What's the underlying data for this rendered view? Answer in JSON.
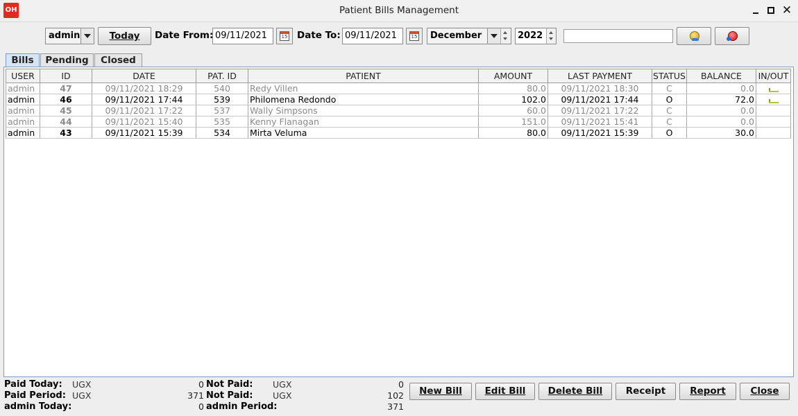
{
  "window": {
    "title": "Patient Bills Management",
    "app_logo": "OH"
  },
  "toolbar": {
    "user_select": "admin",
    "today_label": "Today",
    "date_from_label": "Date From:",
    "date_from_value": "09/11/2021",
    "date_to_label": "Date To:",
    "date_to_value": "09/11/2021",
    "month_select": "December",
    "year_value": "2022",
    "search_value": "",
    "calendar_day": "15",
    "icons": [
      "coin-icon",
      "delete-patient-icon",
      "calendar-icon"
    ]
  },
  "tabs": [
    "Bills",
    "Pending",
    "Closed"
  ],
  "active_tab": "Bills",
  "table": {
    "columns": [
      "USER",
      "ID",
      "DATE",
      "PAT. ID",
      "PATIENT",
      "AMOUNT",
      "LAST PAYMENT",
      "STATUS",
      "BALANCE",
      "IN/OUT"
    ],
    "rows": [
      {
        "user": "admin",
        "id": "47",
        "date": "09/11/2021 18:29",
        "pat_id": "540",
        "patient": "Redy Villen",
        "amount": "80.0",
        "last_payment": "09/11/2021 18:30",
        "status": "C",
        "balance": "0.0",
        "in_out": "in",
        "closed": true
      },
      {
        "user": "admin",
        "id": "46",
        "date": "09/11/2021 17:44",
        "pat_id": "539",
        "patient": "Philomena Redondo",
        "amount": "102.0",
        "last_payment": "09/11/2021 17:44",
        "status": "O",
        "balance": "72.0",
        "in_out": "in",
        "closed": false
      },
      {
        "user": "admin",
        "id": "45",
        "date": "09/11/2021 17:22",
        "pat_id": "537",
        "patient": "Wally Simpsons",
        "amount": "60.0",
        "last_payment": "09/11/2021 17:22",
        "status": "C",
        "balance": "0.0",
        "in_out": "",
        "closed": true
      },
      {
        "user": "admin",
        "id": "44",
        "date": "09/11/2021 15:40",
        "pat_id": "535",
        "patient": "Kenny Flanagan",
        "amount": "151.0",
        "last_payment": "09/11/2021 15:41",
        "status": "C",
        "balance": "0.0",
        "in_out": "",
        "closed": true
      },
      {
        "user": "admin",
        "id": "43",
        "date": "09/11/2021 15:39",
        "pat_id": "534",
        "patient": "Mirta Veluma",
        "amount": "80.0",
        "last_payment": "09/11/2021 15:39",
        "status": "O",
        "balance": "30.0",
        "in_out": "",
        "closed": false
      }
    ]
  },
  "totals": {
    "paid_today_label": "Paid Today:",
    "paid_today_currency": "UGX",
    "paid_today_value": "0",
    "paid_period_label": "Paid Period:",
    "paid_period_currency": "UGX",
    "paid_period_value": "371",
    "user_today_label": "admin Today:",
    "user_today_value": "0",
    "not_paid_label_1": "Not Paid:",
    "not_paid_currency_1": "UGX",
    "not_paid_value_1": "0",
    "not_paid_label_2": "Not Paid:",
    "not_paid_currency_2": "UGX",
    "not_paid_value_2": "102",
    "user_period_label": "admin Period:",
    "user_period_value": "371"
  },
  "actions": {
    "new_bill": "New Bill",
    "edit_bill": "Edit Bill",
    "delete_bill": "Delete Bill",
    "receipt": "Receipt",
    "report": "Report",
    "close": "Close"
  },
  "colors": {
    "closed_row_text": "#8a8a8a",
    "tab_active": "#d7e4f2",
    "logo_bg": "#e22b1e"
  }
}
